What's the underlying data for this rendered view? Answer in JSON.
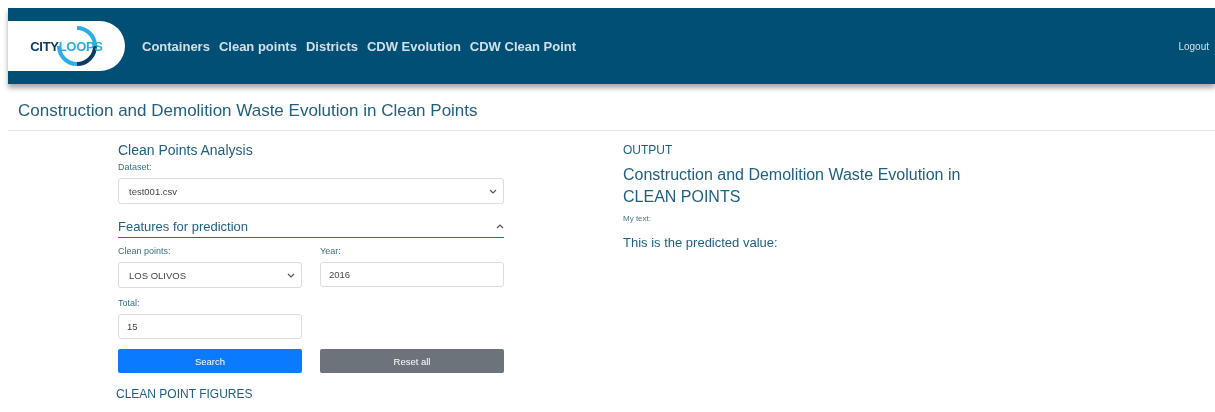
{
  "header": {
    "logo": {
      "part_1": "CITY",
      "part_2": "LOOPS"
    },
    "nav": [
      {
        "label": "Containers"
      },
      {
        "label": "Clean points"
      },
      {
        "label": "Districts"
      },
      {
        "label": "CDW Evolution"
      },
      {
        "label": "CDW Clean Point"
      }
    ],
    "logout": "Logout"
  },
  "page_title": "Construction and Demolition Waste Evolution in Clean Points",
  "analysis": {
    "title": "Clean Points Analysis",
    "dataset": {
      "label": "Dataset:",
      "value": "test001.csv"
    },
    "features": {
      "title": "Features for prediction",
      "expanded": true,
      "clean_points": {
        "label": "Clean points:",
        "value": "LOS OLIVOS"
      },
      "year": {
        "label": "Year:",
        "value": "2016"
      },
      "total": {
        "label": "Total:",
        "value": "15"
      }
    },
    "buttons": [
      {
        "label": "Search",
        "kind": "primary"
      },
      {
        "label": "Reset all",
        "kind": "secondary"
      }
    ],
    "figures_title": "CLEAN POINT FIGURES"
  },
  "output": {
    "label": "OUTPUT",
    "title": "Construction and Demolition Waste Evolution in CLEAN POINTS",
    "note": "My text:",
    "result": "This is the predicted value:"
  }
}
